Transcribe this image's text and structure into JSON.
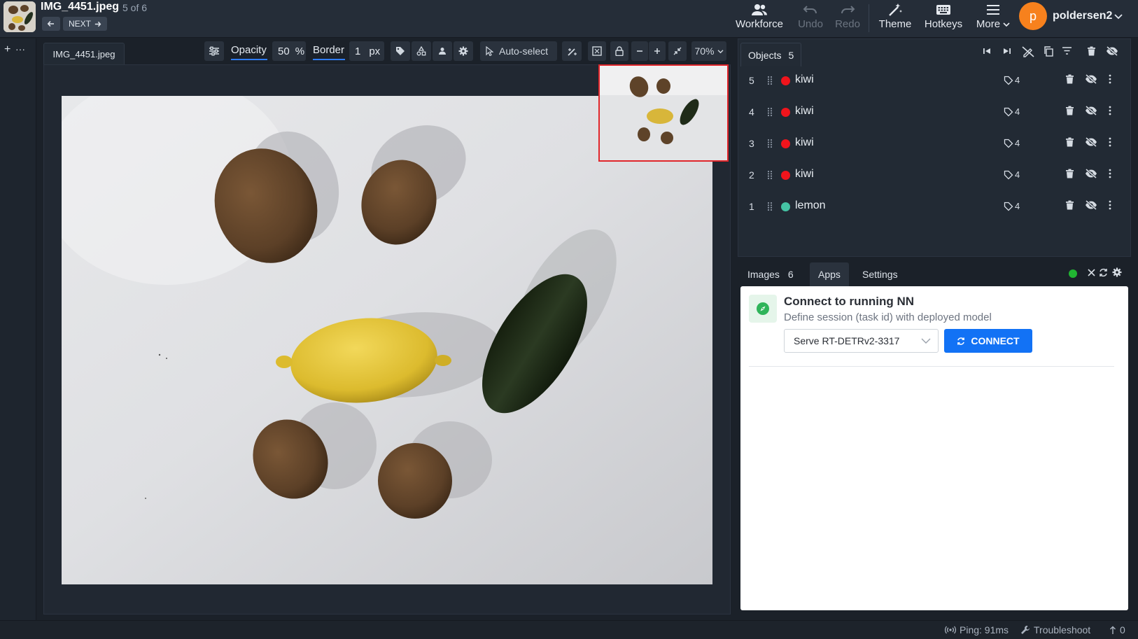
{
  "header": {
    "file_name": "IMG_4451.jpeg",
    "file_position": "5 of 6",
    "next_label": "NEXT",
    "menu": {
      "workforce": "Workforce",
      "undo": "Undo",
      "redo": "Redo",
      "theme": "Theme",
      "hotkeys": "Hotkeys",
      "more": "More"
    },
    "avatar_letter": "p",
    "username": "poldersen2",
    "avatar_color": "#f7811d"
  },
  "left_strip": {
    "add": "+",
    "more": "···"
  },
  "canvas": {
    "tab_label": "IMG_4451.jpeg",
    "toolbar": {
      "opacity_label": "Opacity",
      "opacity_value": "50",
      "opacity_unit": "%",
      "border_label": "Border",
      "border_value": "1",
      "border_unit": "px",
      "auto_select": "Auto-select",
      "zoom": "70%"
    }
  },
  "objects": {
    "tab_label": "Objects",
    "count": "5",
    "items": [
      {
        "num": "5",
        "label": "kiwi",
        "color": "#f0141c",
        "tags": "4"
      },
      {
        "num": "4",
        "label": "kiwi",
        "color": "#f0141c",
        "tags": "4"
      },
      {
        "num": "3",
        "label": "kiwi",
        "color": "#f0141c",
        "tags": "4"
      },
      {
        "num": "2",
        "label": "kiwi",
        "color": "#f0141c",
        "tags": "4"
      },
      {
        "num": "1",
        "label": "lemon",
        "color": "#45c3a4",
        "tags": "4"
      }
    ]
  },
  "lower_tabs": {
    "images_label": "Images",
    "images_count": "6",
    "apps_label": "Apps",
    "settings_label": "Settings",
    "status_color": "#21b532"
  },
  "app": {
    "title": "Connect to running NN",
    "description": "Define session (task id) with deployed model",
    "selected_session": "Serve RT-DETRv2-3317",
    "connect_label": "CONNECT",
    "accent": "#1272f5"
  },
  "status": {
    "ping": "Ping: 91ms",
    "troubleshoot": "Troubleshoot",
    "uploads": "0"
  }
}
